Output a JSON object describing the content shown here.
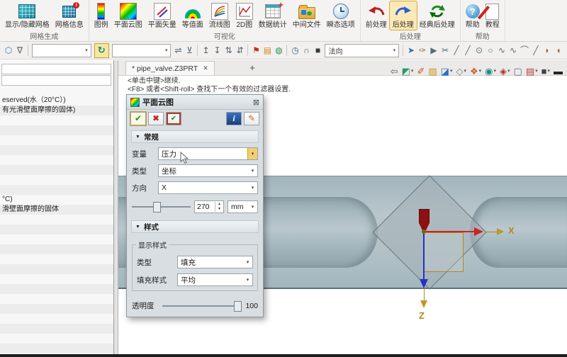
{
  "ribbon": {
    "groups": [
      {
        "label": "网格生成",
        "items": [
          {
            "label": "显示/隐藏网格"
          },
          {
            "label": "网格信息"
          }
        ]
      },
      {
        "label": "可视化",
        "items": [
          {
            "label": "图例"
          },
          {
            "label": "平面云图"
          },
          {
            "label": "平面矢量"
          },
          {
            "label": "等值面"
          },
          {
            "label": "流线图"
          },
          {
            "label": "2D图"
          },
          {
            "label": "数据统计"
          },
          {
            "label": "中间文件"
          },
          {
            "label": "瞬态选项"
          }
        ]
      },
      {
        "label": "后处理",
        "items": [
          {
            "label": "前处理"
          },
          {
            "label": "后处理"
          },
          {
            "label": "经典后处理"
          }
        ]
      },
      {
        "label": "帮助",
        "items": [
          {
            "label": "帮助"
          },
          {
            "label": "教程"
          }
        ]
      }
    ]
  },
  "quickbar": {
    "icons_a": [
      {
        "name": "pick-filter-icon",
        "glyph": "⬡",
        "color": "#3a6fc0"
      },
      {
        "name": "list-filter-icon",
        "glyph": "∇",
        "color": "#555b66"
      }
    ],
    "select1_value": "",
    "refresh_button_glyph": "↻",
    "select2_value": "",
    "icons_c": [
      {
        "name": "swap-icon",
        "glyph": "⇌",
        "color": "#556070"
      },
      {
        "name": "anchor-icon",
        "glyph": "⊻",
        "color": "#556070"
      },
      {
        "sep": true
      },
      {
        "name": "snap-top-icon",
        "glyph": "↥",
        "color": "#556070"
      },
      {
        "name": "snap-bottom-icon",
        "glyph": "↧",
        "color": "#556070"
      },
      {
        "name": "snap-updown-icon",
        "glyph": "⇅",
        "color": "#556070"
      },
      {
        "name": "snap-downup-icon",
        "glyph": "⇵",
        "color": "#556070"
      },
      {
        "sep": true
      },
      {
        "name": "flag-icon",
        "glyph": "⚑",
        "color": "#c03020"
      },
      {
        "name": "layers-icon",
        "glyph": "▤",
        "color": "#d8821a"
      },
      {
        "name": "palette-icon",
        "glyph": "◍",
        "color": "#2a8f5a"
      },
      {
        "sep": true
      },
      {
        "name": "history-icon",
        "glyph": "◷",
        "color": "#44617d"
      },
      {
        "name": "lasso-icon",
        "glyph": "∩",
        "color": "#44617d"
      },
      {
        "name": "stop-icon",
        "glyph": "■",
        "color": "#3a3a3a"
      }
    ],
    "direction_select_value": "法向",
    "icons_d": [
      {
        "name": "pick-arrow-icon",
        "glyph": "➤",
        "color": "#3b6ea5"
      },
      {
        "name": "brush-icon",
        "glyph": "✑",
        "color": "#8a6a4a"
      },
      {
        "name": "play-icon",
        "glyph": "▶",
        "color": "#5a6a75"
      },
      {
        "name": "trim-icon",
        "glyph": "✂",
        "color": "#5a6a75"
      },
      {
        "name": "line-icon",
        "glyph": "╱",
        "color": "#5a6a75"
      },
      {
        "name": "polyline-icon",
        "glyph": "╱",
        "color": "#5a6a75"
      },
      {
        "name": "circle-center-icon",
        "glyph": "⊙",
        "color": "#5a6a75"
      },
      {
        "name": "circle-icon",
        "glyph": "○",
        "color": "#5a6a75"
      },
      {
        "name": "spline-icon",
        "glyph": "∿",
        "color": "#5a6a75"
      },
      {
        "name": "wave-icon",
        "glyph": "∿",
        "color": "#5a6a75"
      },
      {
        "name": "arc-icon",
        "glyph": "⌒",
        "color": "#5a6a75"
      },
      {
        "name": "line2-icon",
        "glyph": "╱",
        "color": "#5a6a75"
      },
      {
        "name": "fillet-icon",
        "glyph": "◗",
        "color": "#9a6a3a"
      },
      {
        "name": "offset-icon",
        "glyph": "◖",
        "color": "#9a6a3a"
      }
    ]
  },
  "tabbar": {
    "tab_label": "* pipe_valve.Z3PRT",
    "tab_close": "✕",
    "new_tab": "+"
  },
  "prompt": {
    "line1": "<单击中键>继续.",
    "line2": "<F8> 或者<Shift-roll> 查找下一个有效的过滤器设置."
  },
  "view_toolbar": {
    "icons": [
      {
        "name": "back-view-icon",
        "glyph": "⇦",
        "color": "#55636e",
        "caret": false
      },
      {
        "name": "render-mode-icon",
        "glyph": "◩",
        "color": "#2a9a6a",
        "caret": true
      },
      {
        "name": "eraser-icon",
        "glyph": "✐",
        "color": "#c05540",
        "caret": false
      },
      {
        "name": "yellow-box-icon",
        "glyph": "▧",
        "color": "#c79421",
        "caret": false
      },
      {
        "name": "blue-box-icon",
        "glyph": "◪",
        "color": "#2a6fc4",
        "caret": true
      },
      {
        "name": "wireframe-cube-icon",
        "glyph": "◇",
        "color": "#70808a",
        "caret": true
      },
      {
        "name": "shaded-display-icon",
        "glyph": "❖",
        "color": "#c06030",
        "caret": true
      },
      {
        "name": "camera-view-icon",
        "glyph": "◉",
        "color": "#1a8a7a",
        "caret": true
      },
      {
        "name": "section-view-icon",
        "glyph": "◈",
        "color": "#b03030",
        "caret": true
      },
      {
        "name": "window-icon",
        "glyph": "▢",
        "color": "#5a6a75",
        "caret": false
      },
      {
        "name": "split-view-icon",
        "glyph": "▤",
        "color": "#b04040",
        "caret": true
      },
      {
        "name": "background-icon",
        "glyph": "■",
        "color": "#3a4450",
        "caret": true
      },
      {
        "name": "minimize-icon",
        "glyph": "▬",
        "color": "#222222",
        "caret": false
      }
    ]
  },
  "left_panel": {
    "rows": [
      "eserved(水（20°C）)",
      "有光滑壁面摩擦的固体)",
      "",
      "",
      "",
      "",
      "",
      "",
      "",
      "",
      "°C)",
      "滑壁面摩擦的固体",
      "",
      "",
      "",
      "",
      "",
      "",
      "",
      "",
      "",
      "",
      "",
      "",
      "",
      ""
    ]
  },
  "dialog": {
    "title": "平面云图",
    "close_glyph": "⊠",
    "ok_glyph": "✔",
    "cancel_glyph": "✖",
    "apply_glyph": "✔",
    "info_glyph": "i",
    "doc_glyph": "✎",
    "collapse_glyph": "▼",
    "caret": "▾",
    "spin_up": "▲",
    "spin_down": "▼",
    "general_section": "常规",
    "variable_label": "变量",
    "variable_value": "压力",
    "type_label": "类型",
    "type_value": "坐标",
    "direction_label": "方向",
    "direction_value": "X",
    "offset_value": "270",
    "offset_unit": "mm",
    "style_section": "样式",
    "display_style_group": "显示样式",
    "style_type_label": "类型",
    "style_type_value": "填充",
    "fill_style_label": "填充样式",
    "fill_style_value": "平均",
    "transparency_label": "透明度",
    "transparency_value": "100"
  },
  "viewport": {
    "axis_x_label": "X",
    "axis_z_label": "Z"
  },
  "colors": {
    "ribbon_highlight": "#fbe9b6",
    "highlight_border": "#d9a93c",
    "pre_arrow": "#b22222",
    "post_arrow": "#2a5fd4",
    "pipe_body": "#b3c2c8",
    "axis_gold": "#b08a20",
    "axis_red": "#cf2222",
    "axis_blue": "#2531c8",
    "handle_red": "#8e1111",
    "dialog_bg": "#d8dee2"
  }
}
